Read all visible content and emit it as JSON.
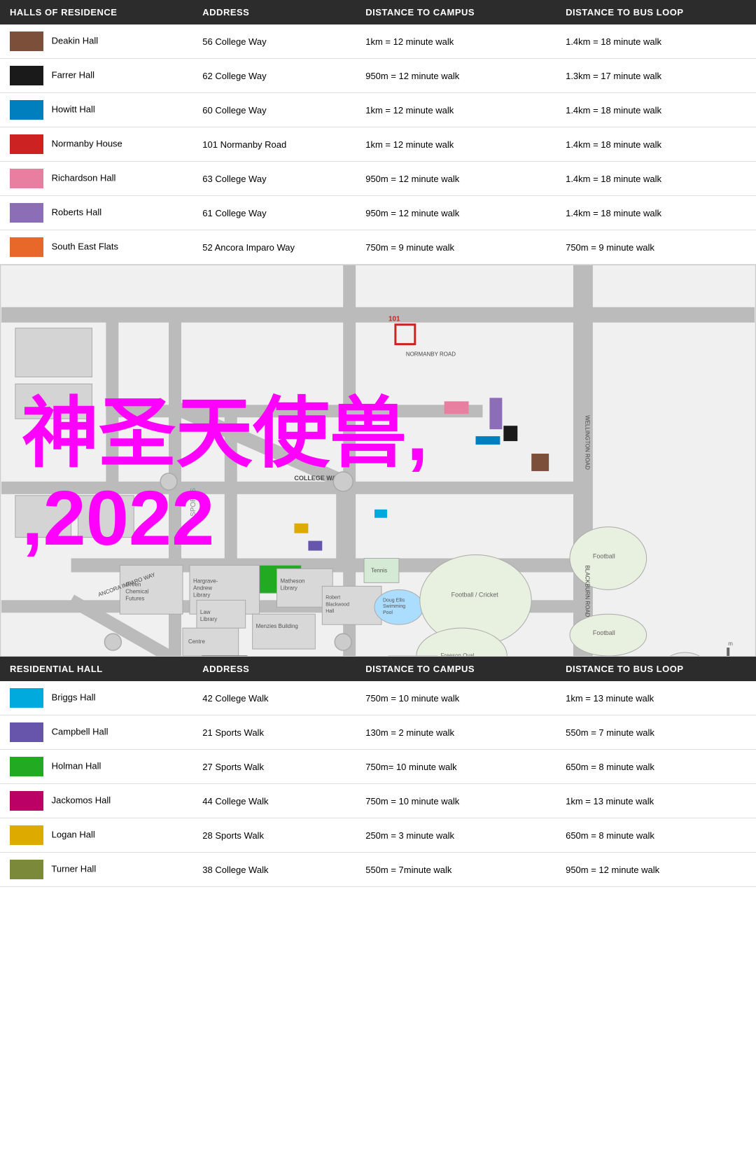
{
  "topTable": {
    "headers": [
      "HALLS OF RESIDENCE",
      "ADDRESS",
      "DISTANCE TO CAMPUS",
      "DISTANCE TO BUS  LOOP"
    ],
    "rows": [
      {
        "color": "#7B4F3A",
        "name": "Deakin Hall",
        "address": "56 College Way",
        "campus": "1km = 12 minute walk",
        "bus": "1.4km = 18 minute walk"
      },
      {
        "color": "#1a1a1a",
        "name": "Farrer Hall",
        "address": "62 College Way",
        "campus": "950m = 12 minute walk",
        "bus": "1.3km = 17 minute walk"
      },
      {
        "color": "#007FBF",
        "name": "Howitt Hall",
        "address": "60 College Way",
        "campus": "1km = 12 minute walk",
        "bus": "1.4km = 18 minute walk"
      },
      {
        "color": "#CC2222",
        "name": "Normanby House",
        "address": "101 Normanby Road",
        "campus": "1km = 12 minute walk",
        "bus": "1.4km = 18 minute walk"
      },
      {
        "color": "#E87FA0",
        "name": "Richardson Hall",
        "address": "63 College Way",
        "campus": "950m = 12 minute walk",
        "bus": "1.4km = 18 minute walk"
      },
      {
        "color": "#8B6EB5",
        "name": "Roberts Hall",
        "address": "61 College Way",
        "campus": "950m = 12 minute walk",
        "bus": "1.4km = 18 minute walk"
      },
      {
        "color": "#E8682A",
        "name": "South East Flats",
        "address": "52 Ancora Imparo Way",
        "campus": "750m = 9 minute walk",
        "bus": "750m = 9 minute walk"
      }
    ]
  },
  "mapOverlay": "神圣天使兽\n,2022",
  "mapOverlayLines": [
    "神圣天使兽,",
    ",2022"
  ],
  "bottomTable": {
    "headers": [
      "RESIDENTIAL HALL",
      "ADDRESS",
      "DISTANCE TO CAMPUS",
      "DISTANCE TO BUS LOOP"
    ],
    "rows": [
      {
        "color": "#00AADD",
        "name": "Briggs Hall",
        "address": "42 College Walk",
        "campus": "750m = 10 minute walk",
        "bus": "1km = 13 minute walk"
      },
      {
        "color": "#6655AA",
        "name": "Campbell Hall",
        "address": "21 Sports Walk",
        "campus": "130m = 2 minute walk",
        "bus": "550m = 7 minute walk"
      },
      {
        "color": "#22AA22",
        "name": "Holman Hall",
        "address": "27 Sports Walk",
        "campus": "750m= 10 minute walk",
        "bus": "650m = 8 minute walk"
      },
      {
        "color": "#BB0066",
        "name": "Jackomos Hall",
        "address": "44 College Walk",
        "campus": "750m = 10 minute walk",
        "bus": "1km = 13 minute walk"
      },
      {
        "color": "#DDAA00",
        "name": "Logan Hall",
        "address": "28 Sports Walk",
        "campus": "250m = 3 minute walk",
        "bus": "650m = 8 minute walk"
      },
      {
        "color": "#7A8A3A",
        "name": "Turner Hall",
        "address": "38 College Walk",
        "campus": "550m = 7minute walk",
        "bus": "950m = 12 minute walk"
      }
    ]
  }
}
